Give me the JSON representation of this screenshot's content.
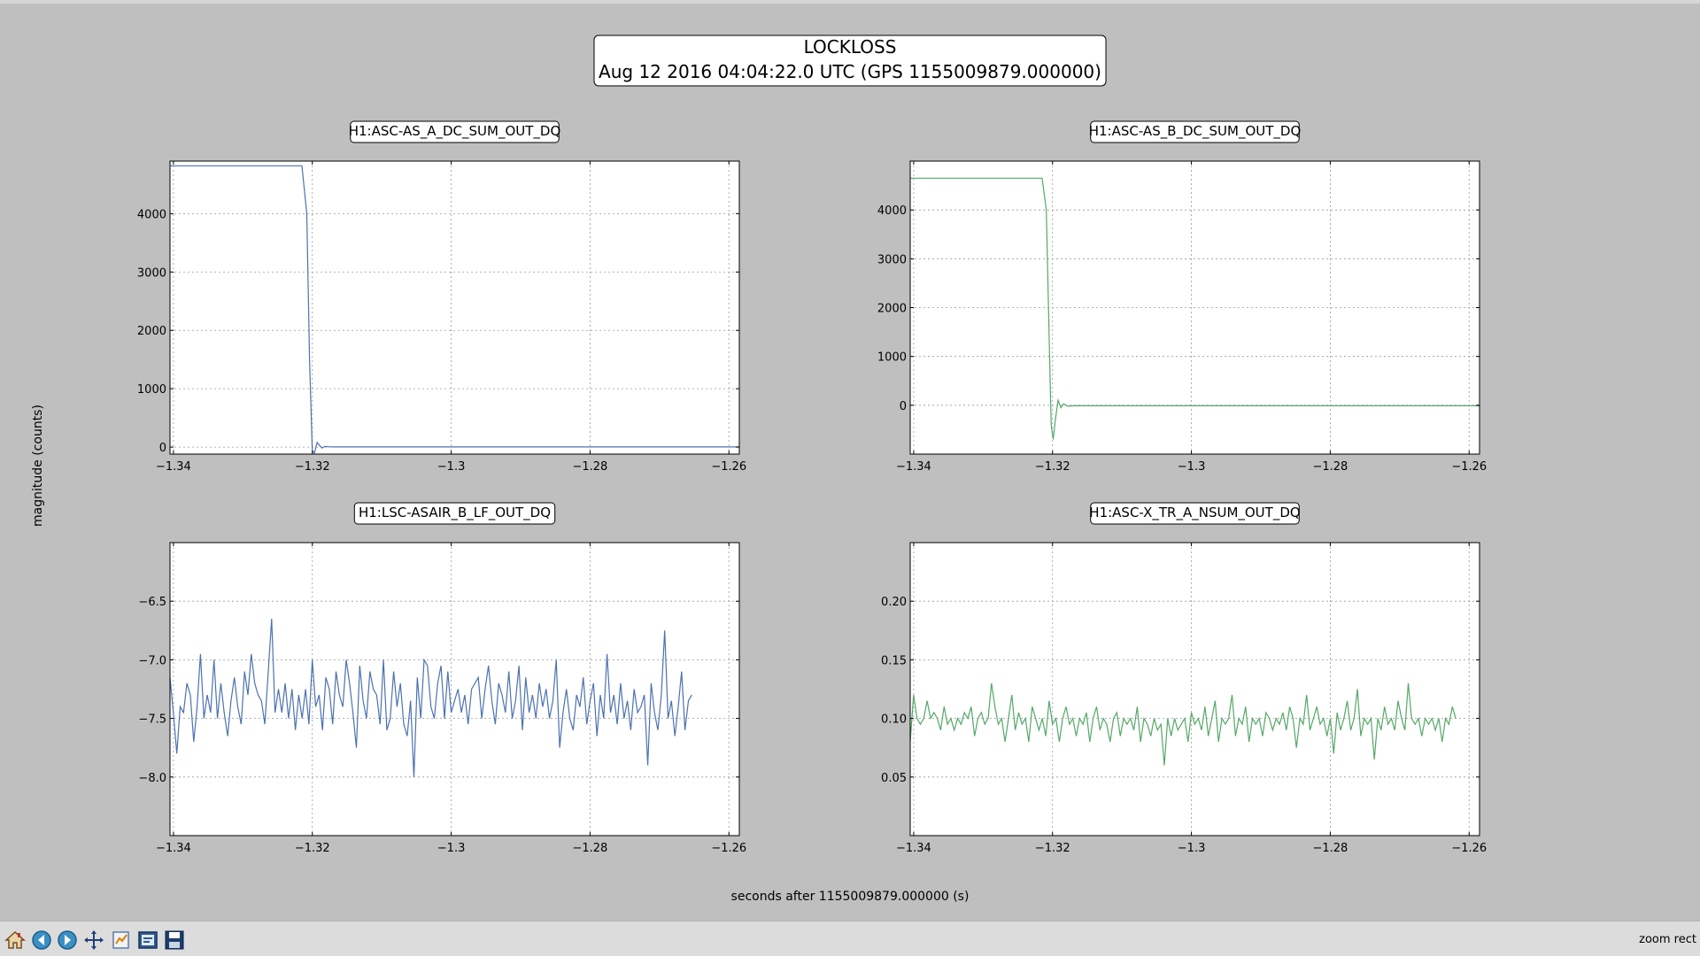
{
  "figure": {
    "title_line1": "LOCKLOSS",
    "title_line2": "Aug 12 2016 04:04:22.0 UTC (GPS 1155009879.000000)",
    "ylabel": "magnitude (counts)",
    "xlabel": "seconds after 1155009879.000000 (s)"
  },
  "toolbar": {
    "status": "zoom rect",
    "buttons": [
      "home-icon",
      "back-icon",
      "forward-icon",
      "pan-icon",
      "subplots-icon",
      "configure-icon",
      "save-icon"
    ]
  },
  "colors": {
    "blue": "#4c72b0",
    "green": "#55a868",
    "background": "#bfbfbf"
  },
  "chart_data": [
    {
      "type": "line",
      "title": "H1:ASC-AS_A_DC_SUM_OUT_DQ",
      "series_color": "blue",
      "xlim": [
        -1.3405,
        -1.2585
      ],
      "ylim": [
        -120,
        4900
      ],
      "xticks": [
        -1.34,
        -1.32,
        -1.3,
        -1.28,
        -1.26
      ],
      "xtick_labels": [
        "−1.34",
        "−1.32",
        "−1.3",
        "−1.28",
        "−1.26"
      ],
      "yticks": [
        0,
        1000,
        2000,
        3000,
        4000
      ],
      "ytick_labels": [
        "0",
        "1000",
        "2000",
        "3000",
        "4000"
      ],
      "grid": true,
      "x": [
        -1.3405,
        -1.3215,
        -1.3208,
        -1.3204,
        -1.32,
        -1.3197,
        -1.3193,
        -1.3189,
        -1.3186,
        -1.3182,
        -1.3175,
        -1.3165,
        -1.2585
      ],
      "y": [
        4820,
        4820,
        4000,
        1500,
        -60,
        -100,
        80,
        20,
        -15,
        10,
        5,
        3,
        3
      ]
    },
    {
      "type": "line",
      "title": "H1:ASC-AS_B_DC_SUM_OUT_DQ",
      "series_color": "green",
      "xlim": [
        -1.3405,
        -1.2585
      ],
      "ylim": [
        -1000,
        5000
      ],
      "xticks": [
        -1.34,
        -1.32,
        -1.3,
        -1.28,
        -1.26
      ],
      "xtick_labels": [
        "−1.34",
        "−1.32",
        "−1.3",
        "−1.28",
        "−1.26"
      ],
      "yticks": [
        0,
        1000,
        2000,
        3000,
        4000
      ],
      "ytick_labels": [
        "0",
        "1000",
        "2000",
        "3000",
        "4000"
      ],
      "grid": true,
      "x": [
        -1.3405,
        -1.3215,
        -1.3209,
        -1.3205,
        -1.3202,
        -1.3199,
        -1.3196,
        -1.3192,
        -1.3188,
        -1.3184,
        -1.3178,
        -1.3168,
        -1.2585
      ],
      "y": [
        4650,
        4650,
        4000,
        1500,
        -400,
        -700,
        -300,
        100,
        -50,
        30,
        -20,
        -10,
        -10
      ]
    },
    {
      "type": "line",
      "title": "H1:LSC-ASAIR_B_LF_OUT_DQ",
      "series_color": "blue",
      "xlim": [
        -1.3405,
        -1.2585
      ],
      "ylim": [
        -8.5,
        -6.0
      ],
      "xticks": [
        -1.34,
        -1.32,
        -1.3,
        -1.28,
        -1.26
      ],
      "xtick_labels": [
        "−1.34",
        "−1.32",
        "−1.3",
        "−1.28",
        "−1.26"
      ],
      "yticks": [
        -8.0,
        -7.5,
        -7.0,
        -6.5
      ],
      "ytick_labels": [
        "−8.0",
        "−7.5",
        "−7.0",
        "−6.5"
      ],
      "grid": true,
      "x_start": -1.3405,
      "x_step": 0.000488,
      "y": [
        -7.15,
        -7.45,
        -7.8,
        -7.4,
        -7.45,
        -7.2,
        -7.3,
        -7.7,
        -7.4,
        -6.95,
        -7.5,
        -7.3,
        -7.45,
        -7.0,
        -7.5,
        -7.2,
        -7.45,
        -7.65,
        -7.35,
        -7.15,
        -7.4,
        -7.55,
        -7.1,
        -7.3,
        -6.95,
        -7.2,
        -7.3,
        -7.35,
        -7.55,
        -7.1,
        -6.65,
        -7.45,
        -7.25,
        -7.45,
        -7.2,
        -7.5,
        -7.25,
        -7.6,
        -7.3,
        -7.5,
        -7.25,
        -7.55,
        -7.0,
        -7.4,
        -7.3,
        -7.6,
        -7.15,
        -7.25,
        -7.55,
        -7.1,
        -7.3,
        -7.4,
        -7.0,
        -7.2,
        -7.45,
        -7.75,
        -7.05,
        -7.35,
        -7.5,
        -7.1,
        -7.25,
        -7.3,
        -7.55,
        -7.0,
        -7.6,
        -7.5,
        -7.1,
        -7.4,
        -7.2,
        -7.55,
        -7.65,
        -7.35,
        -8.0,
        -7.15,
        -7.5,
        -7.0,
        -7.05,
        -7.4,
        -7.5,
        -7.2,
        -7.05,
        -7.5,
        -7.1,
        -7.45,
        -7.35,
        -7.25,
        -7.45,
        -7.3,
        -7.55,
        -7.25,
        -7.2,
        -7.15,
        -7.5,
        -7.25,
        -7.05,
        -7.35,
        -7.55,
        -7.2,
        -7.3,
        -7.45,
        -7.1,
        -7.5,
        -7.35,
        -7.05,
        -7.6,
        -7.15,
        -7.45,
        -7.3,
        -7.5,
        -7.2,
        -7.4,
        -7.25,
        -7.5,
        -7.35,
        -7.0,
        -7.75,
        -7.45,
        -7.25,
        -7.5,
        -7.6,
        -7.3,
        -7.4,
        -7.15,
        -7.55,
        -7.35,
        -7.2,
        -7.65,
        -7.3,
        -7.5,
        -6.95,
        -7.45,
        -7.3,
        -7.55,
        -7.2,
        -7.5,
        -7.35,
        -7.6,
        -7.25,
        -7.45,
        -7.4,
        -7.3,
        -7.9,
        -7.2,
        -7.45,
        -7.6,
        -7.3,
        -6.75,
        -7.5,
        -7.35,
        -7.65,
        -7.4,
        -7.1,
        -7.6,
        -7.35,
        -7.3
      ]
    },
    {
      "type": "line",
      "title": "H1:ASC-X_TR_A_NSUM_OUT_DQ",
      "series_color": "green",
      "xlim": [
        -1.3405,
        -1.2585
      ],
      "ylim": [
        0.0,
        0.25
      ],
      "xticks": [
        -1.34,
        -1.32,
        -1.3,
        -1.28,
        -1.26
      ],
      "xtick_labels": [
        "−1.34",
        "−1.32",
        "−1.3",
        "−1.28",
        "−1.26"
      ],
      "yticks": [
        0.05,
        0.1,
        0.15,
        0.2
      ],
      "ytick_labels": [
        "0.05",
        "0.10",
        "0.15",
        "0.20"
      ],
      "grid": true,
      "x_start": -1.3405,
      "x_step": 0.000488,
      "y": [
        0.08,
        0.12,
        0.1,
        0.095,
        0.1,
        0.115,
        0.1,
        0.105,
        0.1,
        0.09,
        0.11,
        0.095,
        0.1,
        0.09,
        0.1,
        0.095,
        0.105,
        0.1,
        0.11,
        0.085,
        0.1,
        0.105,
        0.095,
        0.1,
        0.13,
        0.11,
        0.095,
        0.1,
        0.08,
        0.1,
        0.12,
        0.09,
        0.105,
        0.095,
        0.1,
        0.08,
        0.11,
        0.1,
        0.09,
        0.1,
        0.085,
        0.115,
        0.095,
        0.1,
        0.08,
        0.1,
        0.11,
        0.095,
        0.1,
        0.085,
        0.1,
        0.095,
        0.105,
        0.08,
        0.1,
        0.11,
        0.09,
        0.1,
        0.095,
        0.08,
        0.1,
        0.105,
        0.085,
        0.1,
        0.095,
        0.1,
        0.09,
        0.11,
        0.08,
        0.1,
        0.095,
        0.085,
        0.1,
        0.09,
        0.095,
        0.06,
        0.1,
        0.085,
        0.1,
        0.09,
        0.095,
        0.1,
        0.08,
        0.105,
        0.095,
        0.1,
        0.09,
        0.11,
        0.085,
        0.1,
        0.115,
        0.08,
        0.1,
        0.095,
        0.1,
        0.12,
        0.085,
        0.1,
        0.095,
        0.11,
        0.08,
        0.1,
        0.095,
        0.1,
        0.085,
        0.105,
        0.1,
        0.09,
        0.1,
        0.095,
        0.105,
        0.09,
        0.11,
        0.1,
        0.075,
        0.1,
        0.095,
        0.12,
        0.09,
        0.1,
        0.11,
        0.095,
        0.1,
        0.085,
        0.1,
        0.07,
        0.105,
        0.09,
        0.1,
        0.115,
        0.09,
        0.1,
        0.125,
        0.085,
        0.1,
        0.095,
        0.1,
        0.065,
        0.1,
        0.09,
        0.11,
        0.095,
        0.1,
        0.09,
        0.115,
        0.1,
        0.09,
        0.13,
        0.1,
        0.095,
        0.1,
        0.085,
        0.1,
        0.095,
        0.1,
        0.09,
        0.1,
        0.08,
        0.1,
        0.095,
        0.11,
        0.1
      ]
    }
  ]
}
